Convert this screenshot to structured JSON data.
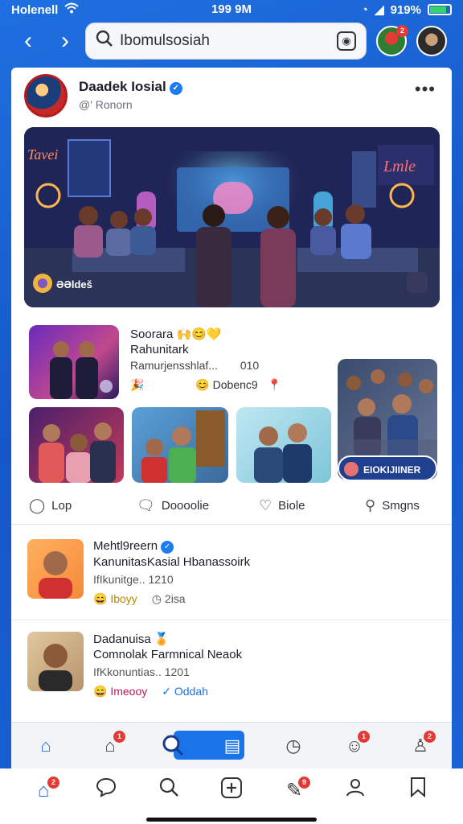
{
  "status_bar": {
    "carrier": "Holenell",
    "time": "199 9M",
    "battery": "919%"
  },
  "top_nav": {
    "search_text": "Ibomulsosiah"
  },
  "post": {
    "author": "Daadek Iosial",
    "subtitle": "@' Ronorn",
    "photo_caption": "ƏƏldeš",
    "items": {
      "title": "Soorara",
      "title_line2": "Rahunitark",
      "subtitle": "Ramurjensshlaf...",
      "count": "010",
      "reaction_label": "Dobenc9",
      "pill_label": "EIOKIJIINER"
    },
    "actions": [
      {
        "label": "Lop"
      },
      {
        "label": "Doooolie"
      },
      {
        "label": "Biole"
      },
      {
        "label": "Smgns"
      }
    ]
  },
  "list": [
    {
      "name": "Mehtl9reern",
      "title": "KanunitasKasial Hbanassoirk",
      "meta": "IfIkunitge.. 1210",
      "react_a": "Iboyy",
      "react_b": "2isa"
    },
    {
      "name": "Dadanuisa",
      "title": "Comnolak Farmnical Neaok",
      "meta": "IfKkonuntias.. 1201",
      "react_a": "Imeooy",
      "react_b": "Oddah"
    }
  ],
  "colors": {
    "brand_blue": "#1a73e8",
    "verified": "#1d7cf2",
    "badge_red": "#e53935"
  }
}
